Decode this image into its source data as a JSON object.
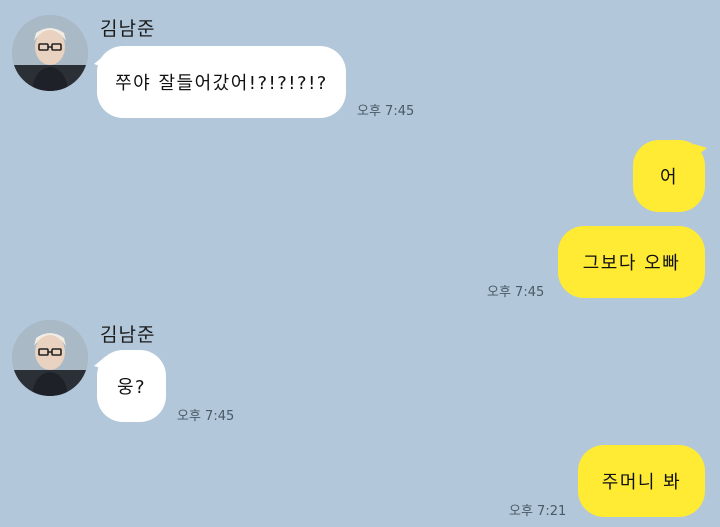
{
  "messages": [
    {
      "sender": "김남준",
      "text": "쭈야 잘들어갔어!?!?!?!?",
      "time": "오후 7:45"
    },
    {
      "text": "어"
    },
    {
      "text": "그보다 오빠",
      "time": "오후 7:45"
    },
    {
      "sender": "김남준",
      "text": "웅?",
      "time": "오후 7:45"
    },
    {
      "text": "주머니 봐",
      "time": "오후 7:21"
    }
  ],
  "colors": {
    "background": "#b2c7d9",
    "incoming_bubble": "#ffffff",
    "outgoing_bubble": "#ffeb33"
  }
}
